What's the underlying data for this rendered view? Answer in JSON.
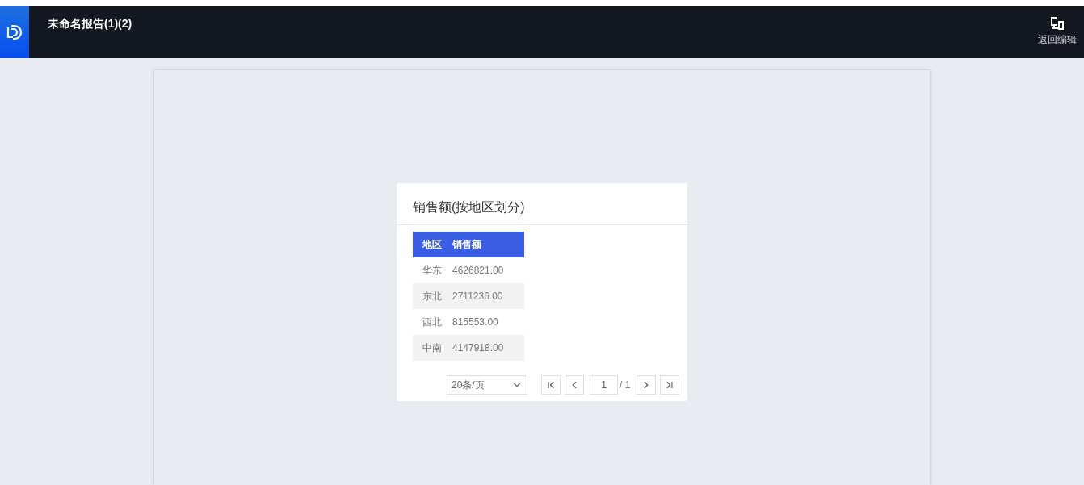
{
  "header": {
    "title": "未命名报告(1)(2)",
    "back_label": "返回编辑"
  },
  "widget": {
    "title": "销售额(按地区划分)",
    "table": {
      "columns": [
        "地区",
        "销售额"
      ],
      "rows": [
        [
          "华东",
          "4626821.00"
        ],
        [
          "东北",
          "2711236.00"
        ],
        [
          "西北",
          "815553.00"
        ],
        [
          "中南",
          "4147918.00"
        ]
      ]
    },
    "pagination": {
      "page_size": "20条/页",
      "page": "1",
      "total": "/ 1"
    }
  }
}
